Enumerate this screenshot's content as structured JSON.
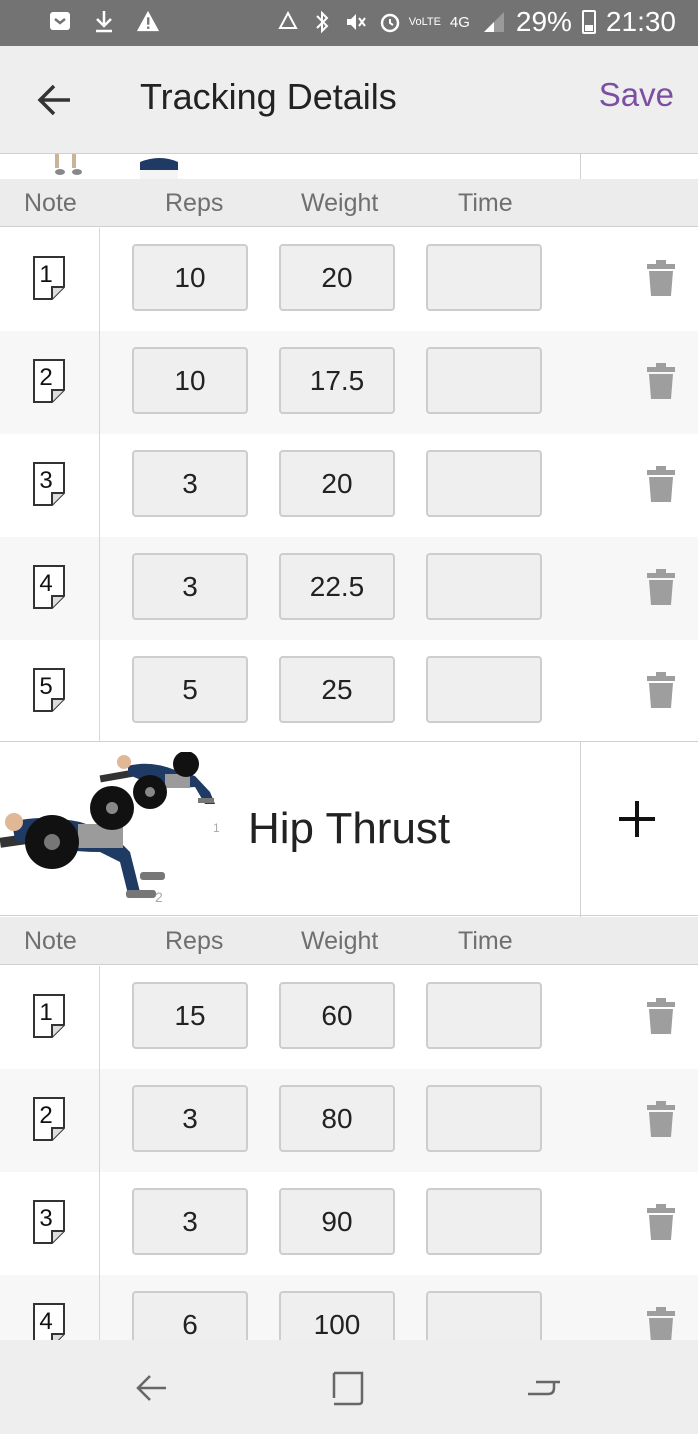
{
  "status_bar": {
    "battery": "29%",
    "time": "21:30",
    "network": "4G",
    "volte": "VoLTE",
    "left_icons": [
      "screenshot-icon",
      "download-icon",
      "warning-icon"
    ],
    "right_icons": [
      "recycle-icon",
      "bluetooth-icon",
      "mute-icon",
      "alarm-icon",
      "volte-icon",
      "4g-icon",
      "signal-icon",
      "battery-icon"
    ]
  },
  "app_bar": {
    "title": "Tracking Details",
    "save_label": "Save"
  },
  "columns": {
    "note": "Note",
    "reps": "Reps",
    "weight": "Weight",
    "time": "Time"
  },
  "exercise1": {
    "sets": [
      {
        "set": "1",
        "reps": "10",
        "weight": "20",
        "time": ""
      },
      {
        "set": "2",
        "reps": "10",
        "weight": "17.5",
        "time": ""
      },
      {
        "set": "3",
        "reps": "3",
        "weight": "20",
        "time": ""
      },
      {
        "set": "4",
        "reps": "3",
        "weight": "22.5",
        "time": ""
      },
      {
        "set": "5",
        "reps": "5",
        "weight": "25",
        "time": ""
      }
    ]
  },
  "exercise2": {
    "name": "Hip Thrust",
    "image_labels": [
      "1",
      "2"
    ],
    "sets": [
      {
        "set": "1",
        "reps": "15",
        "weight": "60",
        "time": ""
      },
      {
        "set": "2",
        "reps": "3",
        "weight": "80",
        "time": ""
      },
      {
        "set": "3",
        "reps": "3",
        "weight": "90",
        "time": ""
      },
      {
        "set": "4",
        "reps": "6",
        "weight": "100",
        "time": ""
      }
    ]
  },
  "colors": {
    "accent": "#7b4fa3",
    "status_bar": "#737373",
    "app_bar": "#eeeeee",
    "field_bg": "#efefef",
    "trash": "#9e9e9e"
  }
}
